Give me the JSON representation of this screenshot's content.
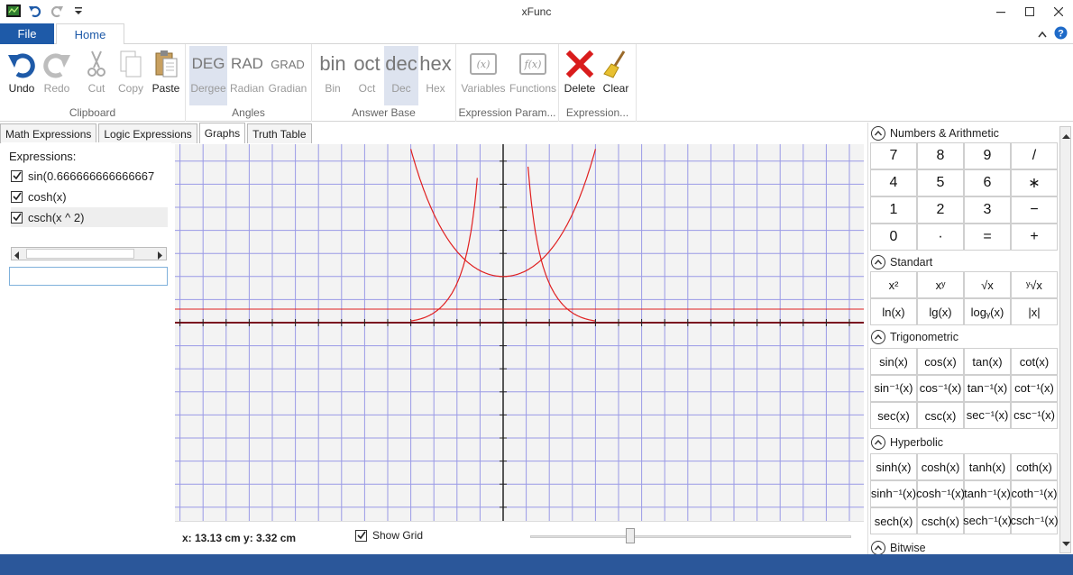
{
  "window": {
    "title": "xFunc"
  },
  "ribbon": {
    "file_tab": "File",
    "home_tab": "Home",
    "clipboard": {
      "label": "Clipboard",
      "undo": "Undo",
      "redo": "Redo",
      "cut": "Cut",
      "copy": "Copy",
      "paste": "Paste"
    },
    "angles": {
      "label": "Angles",
      "deg_big": "DEG",
      "deg": "Dergee",
      "rad_big": "RAD",
      "rad": "Radian",
      "grad_big": "GRAD",
      "grad": "Gradian"
    },
    "answer_base": {
      "label": "Answer Base",
      "bin_big": "bin",
      "bin": "Bin",
      "oct_big": "oct",
      "oct": "Oct",
      "dec_big": "dec",
      "dec": "Dec",
      "hex_big": "hex",
      "hex": "Hex"
    },
    "expression_params": {
      "label": "Expression Param...",
      "variables_icon": "(x)",
      "variables": "Variables",
      "functions_icon": "f(x)",
      "functions": "Functions"
    },
    "expression": {
      "label": "Expression...",
      "delete": "Delete",
      "clear": "Clear"
    }
  },
  "tabs": [
    {
      "label": "Math Expressions"
    },
    {
      "label": "Logic Expressions"
    },
    {
      "label": "Graphs"
    },
    {
      "label": "Truth Table"
    }
  ],
  "expressions": {
    "heading": "Expressions:",
    "items": [
      {
        "text": "sin(0.666666666666667",
        "checked": true
      },
      {
        "text": "cosh(x)",
        "checked": true
      },
      {
        "text": "csch(x ^ 2)",
        "checked": true
      }
    ],
    "input_value": ""
  },
  "graph": {
    "coords": "x: 13.13 cm y: 3.32 cm",
    "show_grid_label": "Show Grid",
    "show_grid": true,
    "zoom_level": 0.3,
    "colors": {
      "grid": "#9a9ae6",
      "axis": "#222222",
      "curve": "#e02020",
      "xaxis": "#7a1020"
    }
  },
  "keypad": {
    "sections": [
      {
        "title": "Numbers & Arithmetic",
        "keys": [
          "7",
          "8",
          "9",
          "/",
          "4",
          "5",
          "6",
          "∗",
          "1",
          "2",
          "3",
          "−",
          "0",
          "·",
          "=",
          "+"
        ]
      },
      {
        "title": "Standart",
        "keys_html": [
          "x²",
          "xʸ",
          "√x",
          "ʸ√x",
          "ln(x)",
          "lg(x)",
          "logᵧ(x)",
          "|x|"
        ]
      },
      {
        "title": "Trigonometric",
        "keys": [
          "sin(x)",
          "cos(x)",
          "tan(x)",
          "cot(x)",
          "sin⁻¹(x)",
          "cos⁻¹(x)",
          "tan⁻¹(x)",
          "cot⁻¹(x)",
          "sec(x)",
          "csc(x)",
          "sec⁻¹(x)",
          "csc⁻¹(x)"
        ]
      },
      {
        "title": "Hyperbolic",
        "keys": [
          "sinh(x)",
          "cosh(x)",
          "tanh(x)",
          "coth(x)",
          "sinh⁻¹(x)",
          "cosh⁻¹(x)",
          "tanh⁻¹(x)",
          "coth⁻¹(x)",
          "sech(x)",
          "csch(x)",
          "sech⁻¹(x)",
          "csch⁻¹(x)"
        ]
      },
      {
        "title": "Bitwise",
        "keys": []
      }
    ]
  }
}
